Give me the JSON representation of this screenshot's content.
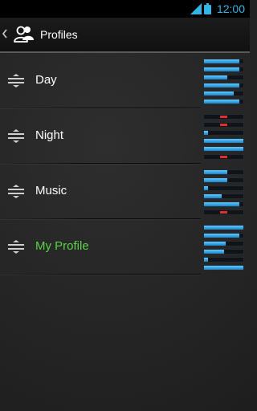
{
  "status_bar": {
    "time": "12:00",
    "accent_color": "#33b5e5",
    "icons": [
      "signal-icon",
      "battery-icon"
    ]
  },
  "action_bar": {
    "title": "Profiles",
    "icons": [
      "back-chevron-icon",
      "profiles-people-icon"
    ]
  },
  "profiles": [
    {
      "name": "Day",
      "selected": false,
      "levels": [
        0.9,
        0.9,
        0.6,
        0.9,
        0.75,
        0.9
      ],
      "muted": [
        false,
        false,
        false,
        false,
        false,
        false
      ]
    },
    {
      "name": "Night",
      "selected": false,
      "levels": [
        0,
        0,
        0.1,
        1.0,
        1.0,
        0
      ],
      "muted": [
        true,
        true,
        false,
        false,
        false,
        true
      ]
    },
    {
      "name": "Music",
      "selected": false,
      "levels": [
        0.6,
        0.6,
        0.1,
        0.45,
        0.9,
        0
      ],
      "muted": [
        false,
        false,
        false,
        false,
        false,
        true
      ]
    },
    {
      "name": "My Profile",
      "selected": true,
      "levels": [
        1.0,
        0.9,
        0.55,
        0.5,
        0.1,
        1.0
      ],
      "muted": [
        false,
        false,
        false,
        false,
        false,
        false
      ]
    }
  ],
  "colors": {
    "selected_label": "#5bd24a",
    "volume_fill": "#3aa6e6",
    "mute_marker": "#e03030"
  }
}
